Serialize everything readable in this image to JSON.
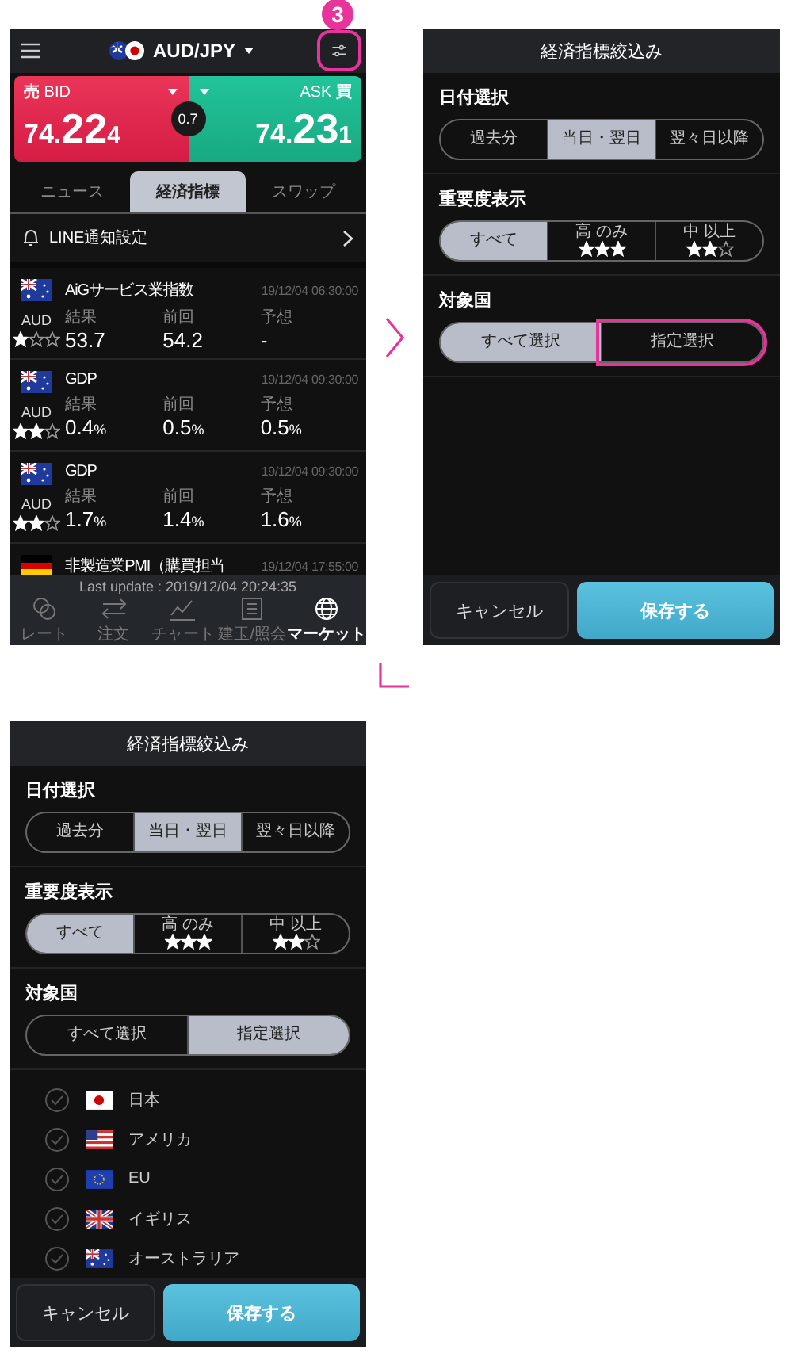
{
  "step_badge": "3",
  "market_screen": {
    "pair": "AUD/JPY",
    "settings_highlighted": true,
    "bid": {
      "label_ja": "売",
      "label": "BID",
      "lead": "74.",
      "big": "22",
      "small": "4"
    },
    "ask": {
      "label": "ASK",
      "label_ja": "買",
      "lead": "74.",
      "big": "23",
      "small": "1"
    },
    "spread": "0.7",
    "tabs": [
      {
        "label": "ニュース",
        "selected": false
      },
      {
        "label": "経済指標",
        "selected": true
      },
      {
        "label": "スワップ",
        "selected": false
      }
    ],
    "notify": "LINE通知設定",
    "events": [
      {
        "kind": "au",
        "currency": "AUD",
        "stars": 1,
        "title": "AiGサービス業指数",
        "time": "19/12/04 06:30:00",
        "figures": [
          {
            "label": "結果",
            "value": "53.7"
          },
          {
            "label": "前回",
            "value": "54.2"
          },
          {
            "label": "予想",
            "value": "-"
          }
        ]
      },
      {
        "kind": "au",
        "currency": "AUD",
        "stars": 2,
        "title": "GDP",
        "time": "19/12/04 09:30:00",
        "figures": [
          {
            "label": "結果",
            "value": "0.4",
            "unit": "%"
          },
          {
            "label": "前回",
            "value": "0.5",
            "unit": "%"
          },
          {
            "label": "予想",
            "value": "0.5",
            "unit": "%"
          }
        ]
      },
      {
        "kind": "au",
        "currency": "AUD",
        "stars": 2,
        "title": "GDP",
        "time": "19/12/04 09:30:00",
        "figures": [
          {
            "label": "結果",
            "value": "1.7",
            "unit": "%"
          },
          {
            "label": "前回",
            "value": "1.4",
            "unit": "%"
          },
          {
            "label": "予想",
            "value": "1.6",
            "unit": "%"
          }
        ]
      },
      {
        "kind": "de",
        "title": "非製造業PMI（購買担当",
        "time": "19/12/04 17:55:00"
      }
    ],
    "last_update": "Last update : 2019/12/04 20:24:35",
    "nav": [
      {
        "kind": "coins",
        "label": "レート",
        "selected": false
      },
      {
        "kind": "arrows",
        "label": "注文",
        "selected": false
      },
      {
        "kind": "chart",
        "label": "チャート",
        "selected": false
      },
      {
        "kind": "list",
        "label": "建玉/照会",
        "selected": false
      },
      {
        "kind": "globe",
        "label": "マーケット",
        "selected": true
      }
    ]
  },
  "filter_screens": [
    {
      "title": "経済指標絞込み",
      "sections": [
        {
          "heading": "日付選択",
          "options": [
            {
              "label": "過去分",
              "selected": false
            },
            {
              "label": "当日・翌日",
              "selected": true
            },
            {
              "label": "翌々日以降",
              "selected": false
            }
          ]
        },
        {
          "heading": "重要度表示",
          "options": [
            {
              "label": "すべて",
              "selected": true
            },
            {
              "label": "高 のみ",
              "stars": 3,
              "selected": false
            },
            {
              "label": "中 以上",
              "stars": 2,
              "selected": false
            }
          ]
        },
        {
          "heading": "対象国",
          "options": [
            {
              "label": "すべて選択",
              "selected": true
            },
            {
              "label": "指定選択",
              "selected": false,
              "highlighted": true
            }
          ]
        }
      ],
      "cancel": "キャンセル",
      "save": "保存する"
    },
    {
      "title": "経済指標絞込み",
      "sections": [
        {
          "heading": "日付選択",
          "options": [
            {
              "label": "過去分",
              "selected": false
            },
            {
              "label": "当日・翌日",
              "selected": true
            },
            {
              "label": "翌々日以降",
              "selected": false
            }
          ]
        },
        {
          "heading": "重要度表示",
          "options": [
            {
              "label": "すべて",
              "selected": true
            },
            {
              "label": "高 のみ",
              "stars": 3,
              "selected": false
            },
            {
              "label": "中 以上",
              "stars": 2,
              "selected": false
            }
          ]
        },
        {
          "heading": "対象国",
          "options": [
            {
              "label": "すべて選択",
              "selected": false
            },
            {
              "label": "指定選択",
              "selected": true
            }
          ]
        }
      ],
      "countries": [
        {
          "kind": "jp",
          "name": "日本",
          "checked": false
        },
        {
          "kind": "us",
          "name": "アメリカ",
          "checked": false
        },
        {
          "kind": "eu",
          "name": "EU",
          "checked": false
        },
        {
          "kind": "gb",
          "name": "イギリス",
          "checked": false
        },
        {
          "kind": "au",
          "name": "オーストラリア",
          "checked": false
        }
      ],
      "cancel": "キャンセル",
      "save": "保存する"
    }
  ]
}
